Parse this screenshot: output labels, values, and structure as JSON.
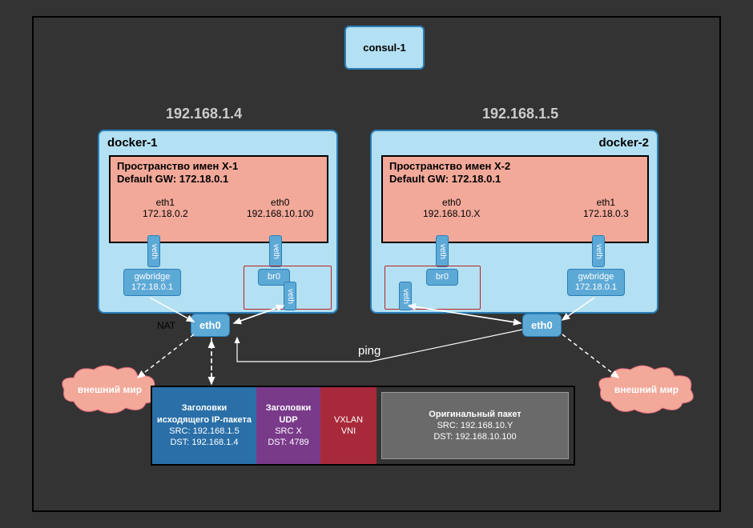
{
  "consul": {
    "label": "consul-1"
  },
  "host1": {
    "ip": "192.168.1.4",
    "title": "docker-1"
  },
  "host2": {
    "ip": "192.168.1.5",
    "title": "docker-2"
  },
  "ns1": {
    "title_line1": "Пространство имен X-1",
    "title_line2": "Default GW: 172.18.0.1",
    "eth1_name": "eth1",
    "eth1_ip": "172.18.0.2",
    "eth0_name": "eth0",
    "eth0_ip": "192.168.10.100"
  },
  "ns2": {
    "title_line1": "Пространство имен X-2",
    "title_line2": "Default GW: 172.18.0.1",
    "eth0_name": "eth0",
    "eth0_ip": "192.168.10.X",
    "eth1_name": "eth1",
    "eth1_ip": "172.18.0.3"
  },
  "gwbridge1": {
    "name": "gwbridge",
    "ip": "172.18.0.1"
  },
  "gwbridge2": {
    "name": "gwbridge",
    "ip": "172.18.0.1"
  },
  "br0_1": {
    "name": "br0"
  },
  "br0_2": {
    "name": "br0"
  },
  "veth_label": "veth",
  "eth0_label": "eth0",
  "nat_label": "NAT",
  "cloud_label": "внешний мир",
  "ping_label": "ping",
  "packet": {
    "ip": {
      "title": "Заголовки исходящего IP-пакета",
      "src": "SRC: 192.168.1.5",
      "dst": "DST: 192.168.1.4"
    },
    "udp": {
      "title": "Заголовки UDP",
      "src": "SRC  X",
      "dst": "DST: 4789"
    },
    "vxlan": {
      "line1": "VXLAN",
      "line2": "VNI"
    },
    "orig": {
      "title": "Оригинальный пакет",
      "src": "SRC: 192.168.10.Y",
      "dst": "DST: 192.168.10.100"
    }
  }
}
